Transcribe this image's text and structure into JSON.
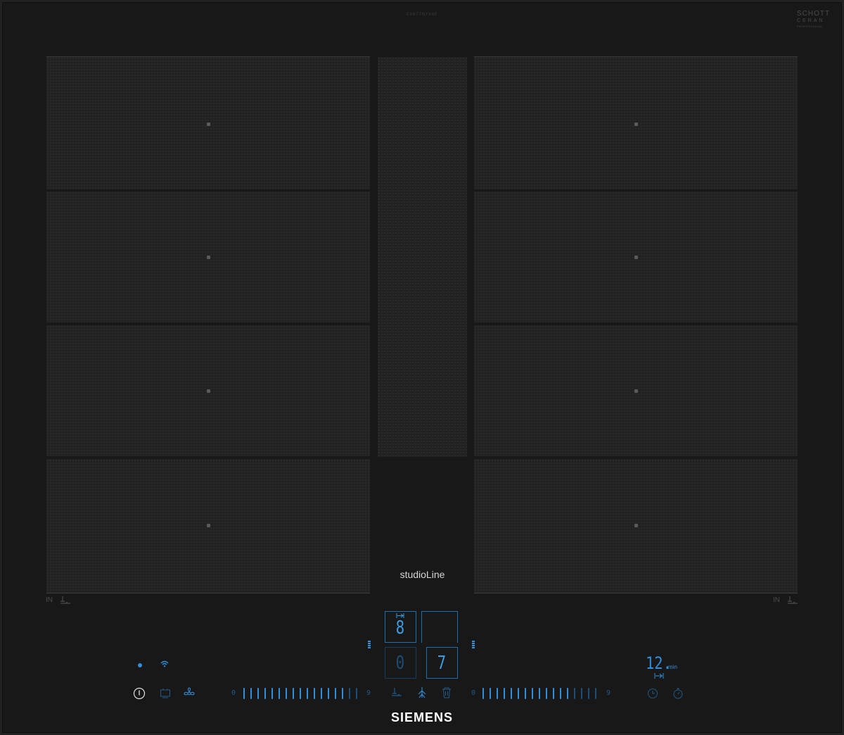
{
  "header": {
    "model_code": "EX677NYX6E",
    "ceran_line1": "SCHOTT",
    "ceran_line2": "CERAN",
    "ceran_line3": "PROFESSIONAL"
  },
  "brand_line": "studioLine",
  "logo": "SIEMENS",
  "left_zone_label": "IN",
  "right_zone_label": "IN",
  "display": {
    "top_left_digit": "8",
    "top_right_digit": "",
    "bottom_left_digit": "0",
    "bottom_right_digit": "7"
  },
  "timer": {
    "value": "12.",
    "unit": "min"
  },
  "sliders": {
    "left_min": "0",
    "left_max": "9",
    "right_min": "0",
    "right_max": "9"
  },
  "colors": {
    "accent": "#2f8fda",
    "accent_dim": "#1c4f78",
    "background": "#181818"
  },
  "icons": [
    "power-icon",
    "wifi-icon",
    "dot-icon",
    "pan-detect-icon",
    "hood-fan-icon",
    "frying-sensor-icon",
    "flex-zone-icon",
    "clean-lock-icon",
    "timer-clock-icon",
    "stopwatch-icon"
  ]
}
